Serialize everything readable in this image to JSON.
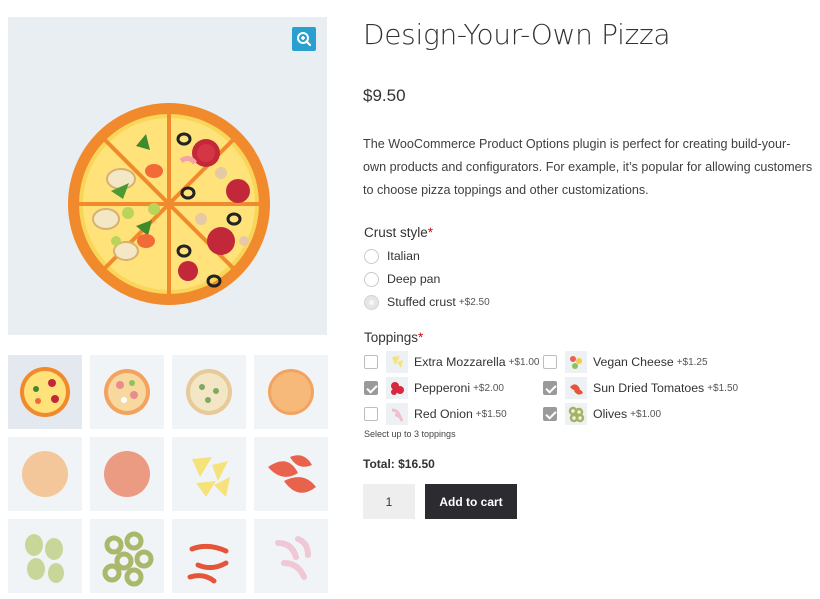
{
  "product": {
    "title": "Design-Your-Own Pizza",
    "price": "$9.50",
    "description": "The WooCommerce Product Options plugin is perfect for creating build-your-own products and configurators. For example, it’s popular for allowing customers to choose pizza toppings and other customizations."
  },
  "gallery": {
    "zoom_icon": "zoom-in-icon",
    "thumbnails": [
      "whole-pizza",
      "pizza-with-ham",
      "pizza-plain-toppings",
      "tomato-sauce-base",
      "dough-base",
      "sauce-base",
      "cheese-triangles",
      "sun-dried-tomatoes",
      "vegan-cheese-pieces",
      "olive-rings",
      "chili-peppers",
      "red-onion-slices"
    ]
  },
  "crust": {
    "label": "Crust style",
    "required_mark": "*",
    "options": [
      {
        "label": "Italian",
        "price": "",
        "selected": false,
        "disabled": false
      },
      {
        "label": "Deep pan",
        "price": "",
        "selected": false,
        "disabled": false
      },
      {
        "label": "Stuffed crust",
        "price": "+$2.50",
        "selected": false,
        "disabled": true
      }
    ]
  },
  "toppings": {
    "label": "Toppings",
    "required_mark": "*",
    "options": [
      {
        "label": "Extra Mozzarella",
        "price": "+$1.00",
        "checked": false
      },
      {
        "label": "Vegan Cheese",
        "price": "+$1.25",
        "checked": false
      },
      {
        "label": "Pepperoni",
        "price": "+$2.00",
        "checked": true
      },
      {
        "label": "Sun Dried Tomatoes",
        "price": "+$1.50",
        "checked": true
      },
      {
        "label": "Red Onion",
        "price": "+$1.50",
        "checked": false
      },
      {
        "label": "Olives",
        "price": "+$1.00",
        "checked": true
      }
    ],
    "hint": "Select up to 3 toppings"
  },
  "cart": {
    "total": "Total: $16.50",
    "quantity": "1",
    "add_label": "Add to cart"
  },
  "colors": {
    "accent": "#2a9fd0",
    "button": "#2b2b30",
    "required": "#d10b0b"
  }
}
